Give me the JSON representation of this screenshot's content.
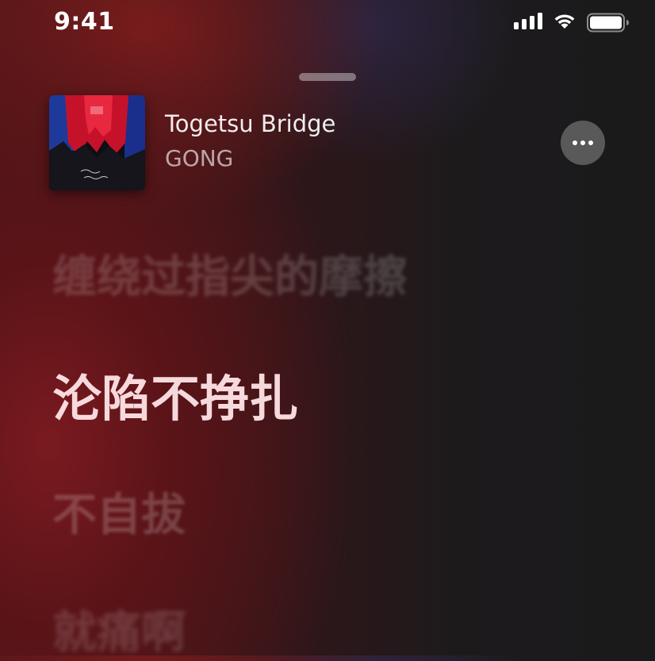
{
  "status_bar": {
    "time": "9:41",
    "icons": [
      "cellular-signal-icon",
      "wifi-icon",
      "battery-icon"
    ]
  },
  "now_playing": {
    "title": "Togetsu Bridge",
    "artist": "GONG",
    "artwork_icon": "album-artwork",
    "more_icon": "ellipsis-icon"
  },
  "lyrics": {
    "previous": "缠绕过指尖的摩擦",
    "current": "沦陷不挣扎",
    "next": "不自拔",
    "after_next": "就痛啊"
  },
  "colors": {
    "background_red": "#7a1a20",
    "background_dark": "#1a1a1b",
    "current_lyric": "#ffe4e8"
  }
}
